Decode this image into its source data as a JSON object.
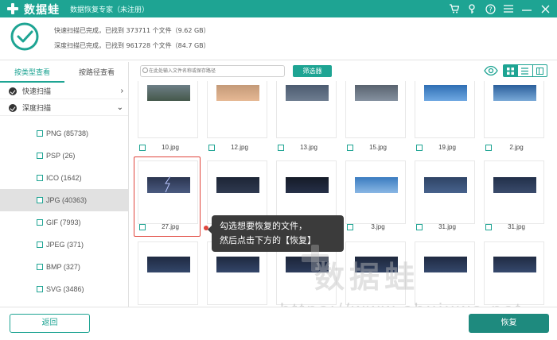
{
  "titlebar": {
    "app_name": "数据蛙",
    "subtitle": "数据恢复专家（未注册）",
    "icons": [
      "cart-icon",
      "key-icon",
      "help-icon",
      "menu-icon",
      "minimize-icon",
      "close-icon"
    ]
  },
  "status": {
    "quick_scan": "快速扫描已完成，已找到 373711 个文件（9.62 GB）",
    "deep_scan": "深度扫描已完成，已找到 961728 个文件（84.7 GB）"
  },
  "sidebar": {
    "tabs": [
      "按类型查看",
      "按路径查看"
    ],
    "scan_rows": [
      {
        "label": "快速扫描",
        "arrow": "›"
      },
      {
        "label": "深度扫描",
        "arrow": "⌄"
      }
    ],
    "file_types": [
      {
        "label": "PNG (85738)",
        "selected": false
      },
      {
        "label": "PSP (26)",
        "selected": false
      },
      {
        "label": "ICO (1642)",
        "selected": false
      },
      {
        "label": "JPG (40363)",
        "selected": true
      },
      {
        "label": "GIF (7993)",
        "selected": false
      },
      {
        "label": "JPEG (371)",
        "selected": false
      },
      {
        "label": "BMP (327)",
        "selected": false
      },
      {
        "label": "SVG (3486)",
        "selected": false
      }
    ]
  },
  "toolbar": {
    "search_placeholder": "在此处输入文件名称或保存路径",
    "filter_label": "筛选器"
  },
  "files": {
    "row1": [
      "10.jpg",
      "12.jpg",
      "13.jpg",
      "15.jpg",
      "19.jpg",
      "2.jpg"
    ],
    "row2": [
      "27.jpg",
      "",
      "",
      "3.jpg",
      "31.jpg",
      "31.jpg"
    ],
    "row3": [
      "",
      "",
      "",
      "",
      "",
      ""
    ]
  },
  "tooltip": {
    "line1": "勾选想要恢复的文件，",
    "line2": "然后点击下方的【恢复】"
  },
  "watermark": {
    "title": "数据蛙",
    "url": "https://www.shujuwa.net"
  },
  "footer": {
    "back_label": "返回",
    "recover_label": "恢复"
  },
  "colors": {
    "accent": "#1ea493",
    "highlight": "#e0463d"
  }
}
